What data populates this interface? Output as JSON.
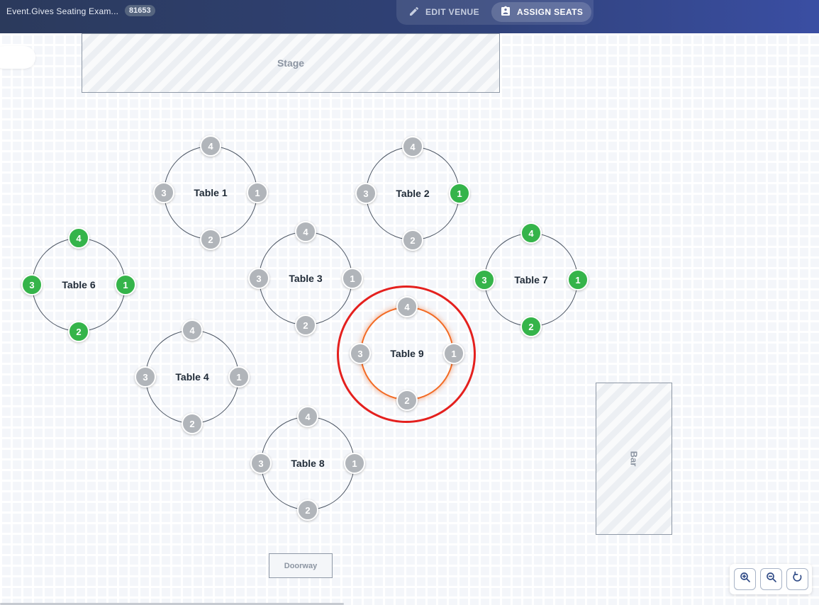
{
  "header": {
    "project_title": "Event.Gives Seating Exam...",
    "project_id": "81653",
    "modes": [
      {
        "label": "EDIT VENUE",
        "icon": "pencil-icon",
        "active": false
      },
      {
        "label": "ASSIGN SEATS",
        "icon": "assign-seat-icon",
        "active": true
      }
    ]
  },
  "fixtures": {
    "stage": "Stage",
    "bar": "Bar",
    "doorway": "Doorway"
  },
  "colors": {
    "seat_empty": "#b1b5ba",
    "seat_assigned": "#35b44a",
    "selected_table_outline": "#f26a24",
    "highlight_ring": "#e4201e"
  },
  "tables": [
    {
      "name": "Table 1",
      "seats": [
        {
          "n": "1",
          "s": "empty"
        },
        {
          "n": "2",
          "s": "empty"
        },
        {
          "n": "3",
          "s": "empty"
        },
        {
          "n": "4",
          "s": "empty"
        }
      ]
    },
    {
      "name": "Table 2",
      "seats": [
        {
          "n": "1",
          "s": "assigned"
        },
        {
          "n": "2",
          "s": "empty"
        },
        {
          "n": "3",
          "s": "empty"
        },
        {
          "n": "4",
          "s": "empty"
        }
      ]
    },
    {
      "name": "Table 3",
      "seats": [
        {
          "n": "1",
          "s": "empty"
        },
        {
          "n": "2",
          "s": "empty"
        },
        {
          "n": "3",
          "s": "empty"
        },
        {
          "n": "4",
          "s": "empty"
        }
      ]
    },
    {
      "name": "Table 4",
      "seats": [
        {
          "n": "1",
          "s": "empty"
        },
        {
          "n": "2",
          "s": "empty"
        },
        {
          "n": "3",
          "s": "empty"
        },
        {
          "n": "4",
          "s": "empty"
        }
      ]
    },
    {
      "name": "Table 6",
      "seats": [
        {
          "n": "1",
          "s": "assigned"
        },
        {
          "n": "2",
          "s": "assigned"
        },
        {
          "n": "3",
          "s": "assigned"
        },
        {
          "n": "4",
          "s": "assigned"
        }
      ]
    },
    {
      "name": "Table 7",
      "seats": [
        {
          "n": "1",
          "s": "assigned"
        },
        {
          "n": "2",
          "s": "assigned"
        },
        {
          "n": "3",
          "s": "assigned"
        },
        {
          "n": "4",
          "s": "assigned"
        }
      ]
    },
    {
      "name": "Table 8",
      "seats": [
        {
          "n": "1",
          "s": "empty"
        },
        {
          "n": "2",
          "s": "empty"
        },
        {
          "n": "3",
          "s": "empty"
        },
        {
          "n": "4",
          "s": "empty"
        }
      ]
    },
    {
      "name": "Table 9",
      "selected": true,
      "seats": [
        {
          "n": "1",
          "s": "empty"
        },
        {
          "n": "2",
          "s": "empty"
        },
        {
          "n": "3",
          "s": "empty"
        },
        {
          "n": "4",
          "s": "empty"
        }
      ]
    }
  ],
  "zoom_controls": [
    {
      "icon": "zoom-in-icon"
    },
    {
      "icon": "zoom-out-icon"
    },
    {
      "icon": "reset-view-icon"
    }
  ]
}
